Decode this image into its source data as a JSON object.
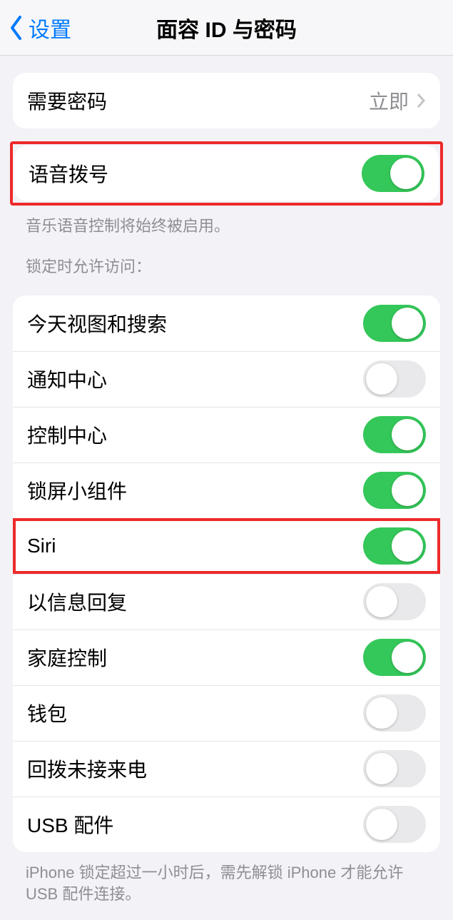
{
  "nav": {
    "back_label": "设置",
    "title": "面容 ID 与密码"
  },
  "group_passcode": {
    "label": "需要密码",
    "value": "立即"
  },
  "group_voice": {
    "label": "语音拨号",
    "enabled": true,
    "footer": "音乐语音控制将始终被启用。"
  },
  "lock_access": {
    "header": "锁定时允许访问：",
    "items": [
      {
        "label": "今天视图和搜索",
        "enabled": true,
        "highlight": false
      },
      {
        "label": "通知中心",
        "enabled": false,
        "highlight": false
      },
      {
        "label": "控制中心",
        "enabled": true,
        "highlight": false
      },
      {
        "label": "锁屏小组件",
        "enabled": true,
        "highlight": false
      },
      {
        "label": "Siri",
        "enabled": true,
        "highlight": true
      },
      {
        "label": "以信息回复",
        "enabled": false,
        "highlight": false
      },
      {
        "label": "家庭控制",
        "enabled": true,
        "highlight": false
      },
      {
        "label": "钱包",
        "enabled": false,
        "highlight": false
      },
      {
        "label": "回拨未接来电",
        "enabled": false,
        "highlight": false
      },
      {
        "label": "USB 配件",
        "enabled": false,
        "highlight": false
      }
    ],
    "footer": "iPhone 锁定超过一小时后，需先解锁 iPhone 才能允许USB 配件连接。"
  }
}
